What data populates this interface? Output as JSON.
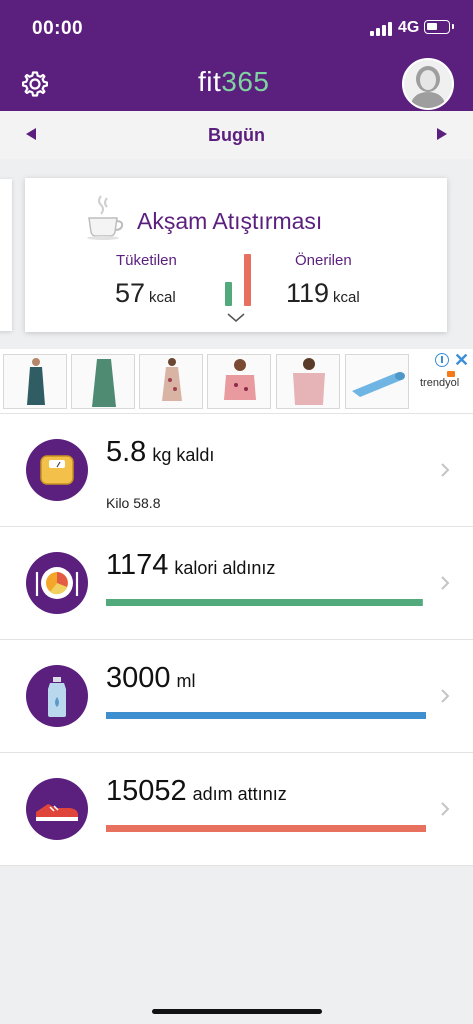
{
  "status_bar": {
    "time": "00:00",
    "network": "4G",
    "battery_level": 0.5
  },
  "header": {
    "logo_fit": "fit",
    "logo_num": "365",
    "settings_icon": "gear-icon",
    "avatar_icon": "user-avatar-icon"
  },
  "date_nav": {
    "label": "Bugün",
    "prev_icon": "triangle-left-icon",
    "next_icon": "triangle-right-icon"
  },
  "meal_card": {
    "title": "Akşam Atıştırması",
    "consumed_label": "Tüketilen",
    "consumed_value": "57",
    "recommended_label": "Önerilen",
    "recommended_value": "119",
    "unit": "kcal",
    "icon": "tea-cup-icon",
    "consumed_color": "#52aa7c",
    "recommended_color": "#e8705f"
  },
  "ad": {
    "brand": "trendyol",
    "info_icon": "ad-info-icon",
    "close_icon": "close-icon"
  },
  "rows": [
    {
      "main_value": "5.8",
      "main_label": "kg kaldı",
      "sub": "Kilo 58.8",
      "icon": "scale-icon"
    },
    {
      "main_value": "1174",
      "main_label": "kalori aldınız",
      "icon": "plate-icon",
      "progress": 0.99,
      "color": "#52aa7c"
    },
    {
      "main_value": "3000",
      "main_label": "ml",
      "icon": "water-bottle-icon",
      "progress": 1.0,
      "color": "#3d8fd0"
    },
    {
      "main_value": "15052",
      "main_label": "adım attınız",
      "icon": "sneaker-icon",
      "progress": 1.0,
      "color": "#e8705f"
    }
  ]
}
